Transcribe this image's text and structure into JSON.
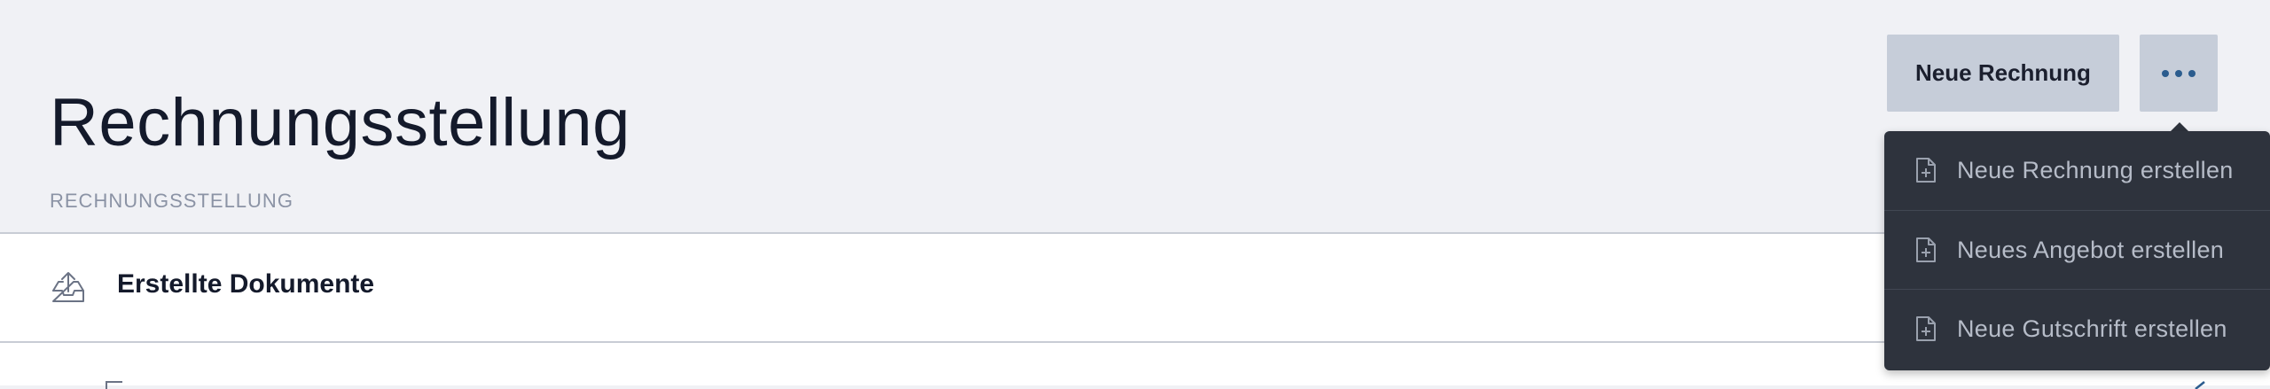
{
  "header": {
    "title": "Rechnungsstellung",
    "primary_button": "Neue Rechnung",
    "more_button_icon": "more-horizontal-icon"
  },
  "breadcrumb": "RECHNUNGSSTELLUNG",
  "list": {
    "items": [
      {
        "label": "Erstellte Dokumente",
        "icon": "upload-tray-icon"
      }
    ]
  },
  "dropdown": {
    "items": [
      {
        "label": "Neue Rechnung erstellen",
        "icon": "file-plus-icon"
      },
      {
        "label": "Neues Angebot erstellen",
        "icon": "file-plus-icon"
      },
      {
        "label": "Neue Gutschrift erstellen",
        "icon": "file-plus-icon"
      }
    ]
  },
  "colors": {
    "background": "#f0f1f5",
    "button": "#c6cdd9",
    "dropdown": "#2e333d",
    "accent": "#2b5c8e"
  }
}
